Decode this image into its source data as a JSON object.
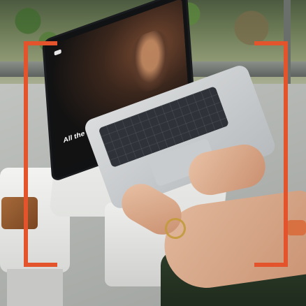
{
  "screen": {
    "nav_items": [
      "",
      "",
      "",
      "",
      "",
      "",
      ""
    ],
    "hero_kicker": "",
    "hero_title": "All the Seasons",
    "hero_subtitle": ""
  },
  "colors": {
    "frame_accent": "#e3542c"
  }
}
